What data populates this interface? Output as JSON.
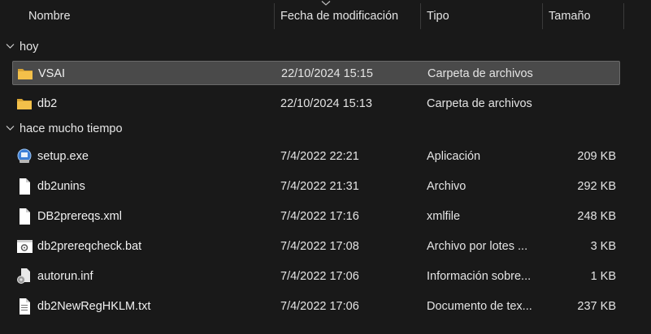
{
  "header": {
    "name": "Nombre",
    "date": "Fecha de modificación",
    "type": "Tipo",
    "size": "Tamaño"
  },
  "groups": [
    {
      "label": "hoy",
      "items": [
        {
          "name": "VSAI",
          "date": "22/10/2024 15:15",
          "type": "Carpeta de archivos",
          "size": "",
          "icon": "folder-icon",
          "selected": true
        },
        {
          "name": "db2",
          "date": "22/10/2024 15:13",
          "type": "Carpeta de archivos",
          "size": "",
          "icon": "folder-icon",
          "selected": false
        }
      ]
    },
    {
      "label": "hace mucho tiempo",
      "items": [
        {
          "name": "setup.exe",
          "date": "7/4/2022 22:21",
          "type": "Aplicación",
          "size": "209 KB",
          "icon": "setup-app-icon"
        },
        {
          "name": "db2unins",
          "date": "7/4/2022 21:31",
          "type": "Archivo",
          "size": "292 KB",
          "icon": "blank-file-icon"
        },
        {
          "name": "DB2prereqs.xml",
          "date": "7/4/2022 17:16",
          "type": "xmlfile",
          "size": "248 KB",
          "icon": "blank-file-icon"
        },
        {
          "name": "db2prereqcheck.bat",
          "date": "7/4/2022 17:08",
          "type": "Archivo por lotes ...",
          "size": "3 KB",
          "icon": "batch-file-icon"
        },
        {
          "name": "autorun.inf",
          "date": "7/4/2022 17:06",
          "type": "Información sobre...",
          "size": "1 KB",
          "icon": "settings-file-icon"
        },
        {
          "name": "db2NewRegHKLM.txt",
          "date": "7/4/2022 17:06",
          "type": "Documento de tex...",
          "size": "237 KB",
          "icon": "text-file-icon"
        }
      ]
    }
  ],
  "colors": {
    "background": "#191919",
    "selection": "#4a4a4a",
    "folder": "#f3c04a"
  }
}
